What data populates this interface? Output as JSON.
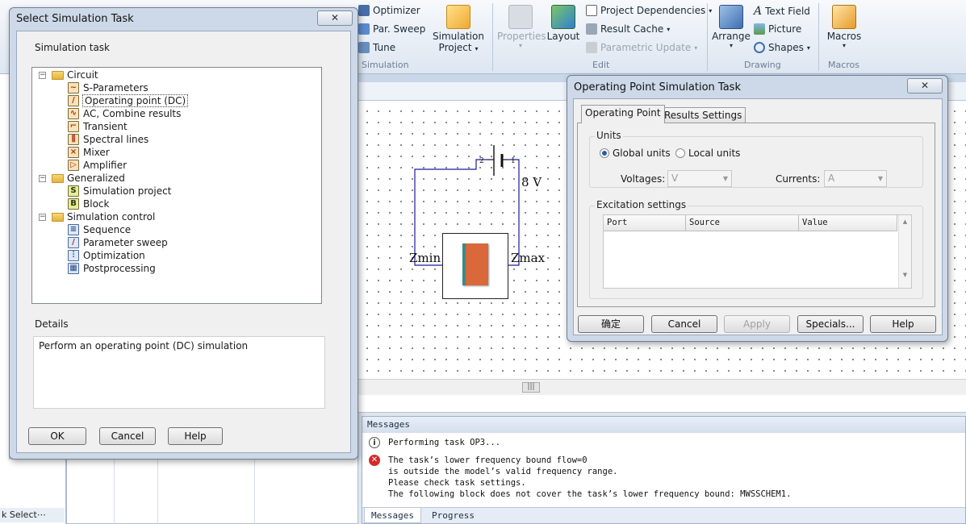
{
  "ribbon": {
    "simulation": {
      "optimizer": "Optimizer",
      "par_sweep": "Par. Sweep",
      "tune": "Tune",
      "simulation_project_l1": "Simulation",
      "simulation_project_l2": "Project",
      "group_label": "Simulation"
    },
    "edit": {
      "properties": "Properties",
      "layout": "Layout",
      "project_dependencies": "Project Dependencies",
      "result_cache": "Result Cache",
      "parametric_update": "Parametric Update",
      "group_label": "Edit"
    },
    "drawing": {
      "arrange": "Arrange",
      "text_field": "Text Field",
      "picture": "Picture",
      "shapes": "Shapes",
      "group_label": "Drawing"
    },
    "macros": {
      "macros": "Macros",
      "group_label": "Macros"
    }
  },
  "left_panel": {
    "block_select_tab": "k Select⋯"
  },
  "schematic": {
    "battery_voltage": "8 V",
    "pin2": "2",
    "pin1": "1",
    "zmin_label": "Zmin",
    "zmax_label": "Zmax"
  },
  "messages": {
    "header": "Messages",
    "lines": [
      "Performing task OP3...",
      "The task’s lower frequency bound flow=0",
      "is outside the model’s valid frequency range.",
      "Please check task settings.",
      "The following block does not cover the task’s lower frequency bound: MWSSCHEM1."
    ],
    "tabs": [
      "Messages",
      "Progress"
    ]
  },
  "select_dialog": {
    "title": "Select Simulation Task",
    "close": "✕",
    "task_group_label": "Simulation task",
    "tree": [
      {
        "label": "Circuit",
        "type": "folder",
        "children": [
          {
            "label": "S-Parameters",
            "icon": "s-parameters-icon"
          },
          {
            "label": "Operating point (DC)",
            "icon": "operating-point-icon",
            "selected": true
          },
          {
            "label": "AC, Combine results",
            "icon": "ac-icon"
          },
          {
            "label": "Transient",
            "icon": "transient-icon"
          },
          {
            "label": "Spectral lines",
            "icon": "spectral-lines-icon"
          },
          {
            "label": "Mixer",
            "icon": "mixer-icon"
          },
          {
            "label": "Amplifier",
            "icon": "amplifier-icon"
          }
        ]
      },
      {
        "label": "Generalized",
        "type": "folder",
        "children": [
          {
            "label": "Simulation project",
            "icon": "simulation-project-icon",
            "glyph": "S"
          },
          {
            "label": "Block",
            "icon": "block-icon",
            "glyph": "B"
          }
        ]
      },
      {
        "label": "Simulation control",
        "type": "folder",
        "children": [
          {
            "label": "Sequence",
            "icon": "sequence-icon"
          },
          {
            "label": "Parameter sweep",
            "icon": "parameter-sweep-icon"
          },
          {
            "label": "Optimization",
            "icon": "optimization-icon"
          },
          {
            "label": "Postprocessing",
            "icon": "postprocessing-icon"
          }
        ]
      }
    ],
    "details_label": "Details",
    "details_text": "Perform an operating point (DC) simulation",
    "ok": "OK",
    "cancel": "Cancel",
    "help": "Help"
  },
  "op_dialog": {
    "title": "Operating Point Simulation Task",
    "close": "✕",
    "tabs": [
      "Operating Point",
      "Results Settings"
    ],
    "units_label": "Units",
    "global_units": "Global units",
    "local_units": "Local units",
    "units_choice": "global",
    "voltages_label": "Voltages:",
    "voltages_value": "V",
    "currents_label": "Currents:",
    "currents_value": "A",
    "excitation_label": "Excitation settings",
    "columns": [
      "Port",
      "Source",
      "Value"
    ],
    "buttons": {
      "ok": "确定",
      "cancel": "Cancel",
      "apply": "Apply",
      "specials": "Specials...",
      "help": "Help"
    }
  },
  "colors": {
    "ribbon_bg": "#dde6f1",
    "dialog_frame": "#cdd9e8",
    "dialog_body": "#f0f0f0",
    "error_red": "#d42a2a",
    "block_orange": "#d9683a"
  }
}
